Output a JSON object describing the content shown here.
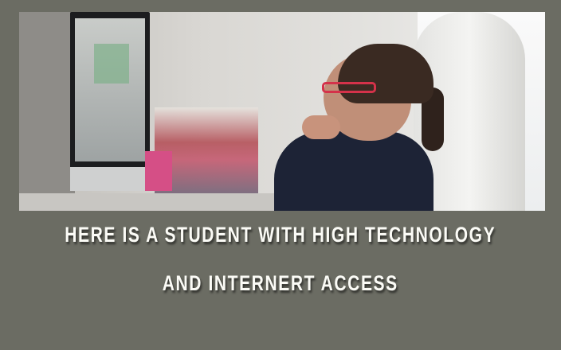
{
  "slide": {
    "photo_alt": "student at computer",
    "caption_line1": "HERE IS A STUDENT WITH HIGH TECHNOLOGY",
    "caption_line2": "AND INTERNERT ACCESS"
  },
  "colors": {
    "background": "#6b6c63",
    "text": "#fbfbf6"
  }
}
